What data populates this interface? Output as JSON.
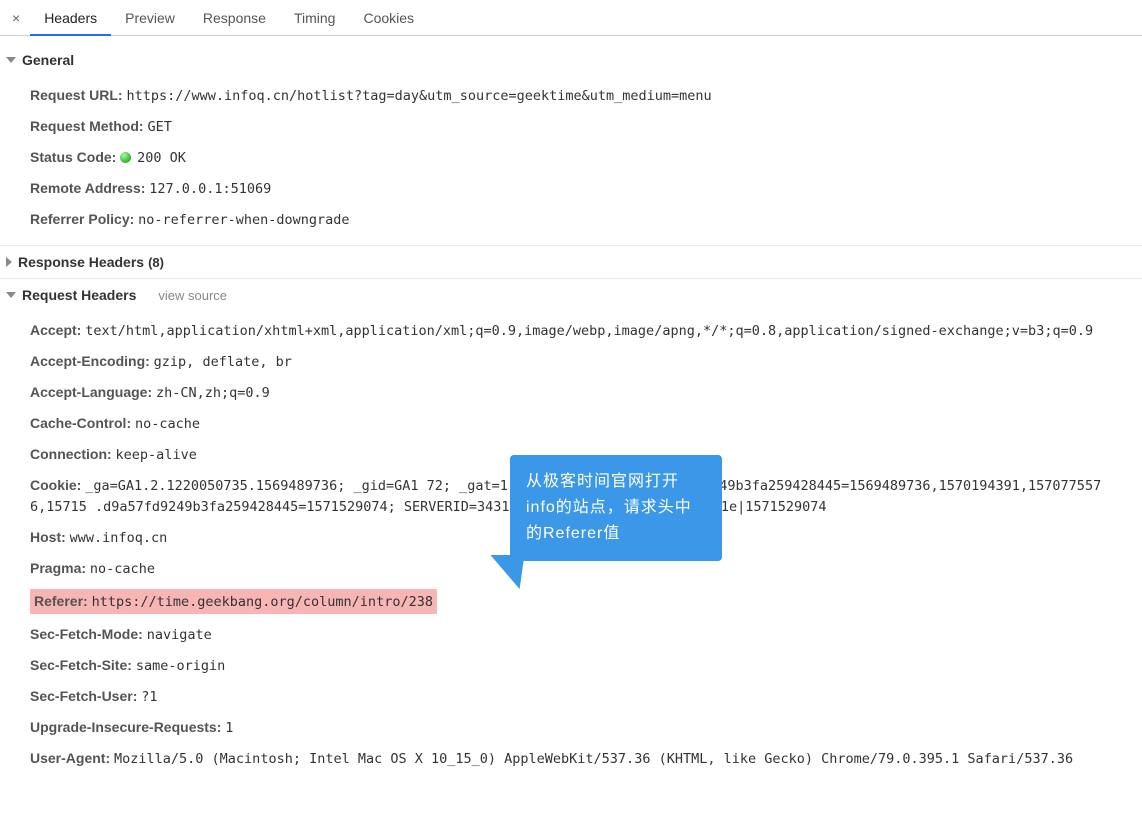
{
  "tabs": {
    "headers": "Headers",
    "preview": "Preview",
    "response": "Response",
    "timing": "Timing",
    "cookies": "Cookies"
  },
  "sections": {
    "general": "General",
    "responseHeaders": "Response Headers",
    "responseHeadersCount": "(8)",
    "requestHeaders": "Request Headers",
    "viewSource": "view source"
  },
  "general": {
    "requestUrl": {
      "k": "Request URL:",
      "v": "https://www.infoq.cn/hotlist?tag=day&utm_source=geektime&utm_medium=menu"
    },
    "requestMethod": {
      "k": "Request Method:",
      "v": "GET"
    },
    "statusCode": {
      "k": "Status Code:",
      "v": "200 OK"
    },
    "remoteAddress": {
      "k": "Remote Address:",
      "v": "127.0.0.1:51069"
    },
    "referrerPolicy": {
      "k": "Referrer Policy:",
      "v": "no-referrer-when-downgrade"
    }
  },
  "requestHeaders": {
    "accept": {
      "k": "Accept:",
      "v": "text/html,application/xhtml+xml,application/xml;q=0.9,image/webp,image/apng,*/*;q=0.8,application/signed-exchange;v=b3;q=0.9"
    },
    "acceptEncoding": {
      "k": "Accept-Encoding:",
      "v": "gzip, deflate, br"
    },
    "acceptLanguage": {
      "k": "Accept-Language:",
      "v": "zh-CN,zh;q=0.9"
    },
    "cacheControl": {
      "k": "Cache-Control:",
      "v": "no-cache"
    },
    "connection": {
      "k": "Connection:",
      "v": "keep-alive"
    },
    "cookie": {
      "k": "Cookie:",
      "v": "_ga=GA1.2.1220050735.1569489736; _gid=GA1             72; _gat=1; Hm_lvt_094d2af1d9a57fd9249b3fa259428445=1569489736,1570194391,1570775576,15715             .d9a57fd9249b3fa259428445=1571529074; SERVERID=3431a294a18c59fc8f5805662e2bd51e|1571529074"
    },
    "host": {
      "k": "Host:",
      "v": "www.infoq.cn"
    },
    "pragma": {
      "k": "Pragma:",
      "v": "no-cache"
    },
    "referer": {
      "k": "Referer:",
      "v": "https://time.geekbang.org/column/intro/238"
    },
    "secFetchMode": {
      "k": "Sec-Fetch-Mode:",
      "v": "navigate"
    },
    "secFetchSite": {
      "k": "Sec-Fetch-Site:",
      "v": "same-origin"
    },
    "secFetchUser": {
      "k": "Sec-Fetch-User:",
      "v": "?1"
    },
    "upgradeInsecure": {
      "k": "Upgrade-Insecure-Requests:",
      "v": "1"
    },
    "userAgent": {
      "k": "User-Agent:",
      "v": "Mozilla/5.0 (Macintosh; Intel Mac OS X 10_15_0) AppleWebKit/537.36 (KHTML, like Gecko) Chrome/79.0.395.1 Safari/537.36"
    }
  },
  "annotation": {
    "text": "从极客时间官网打开info的站点，请求头中的Referer值"
  }
}
